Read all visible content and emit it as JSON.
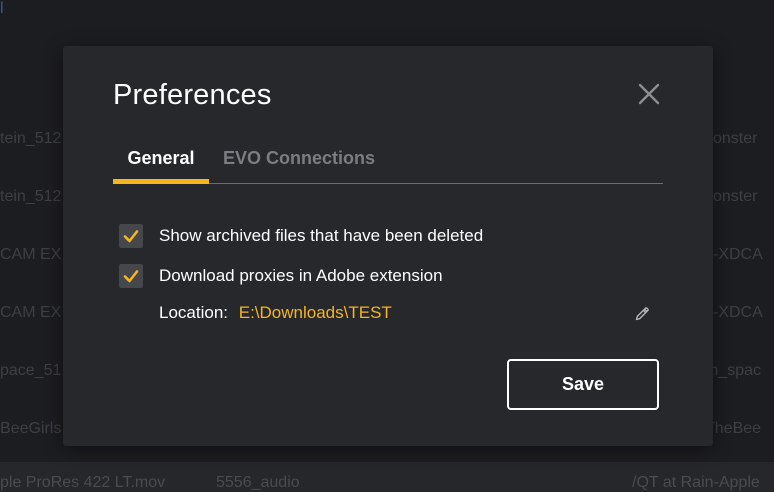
{
  "background": {
    "top_glyph": "l",
    "rows": [
      {
        "left": "tein_512",
        "right": "konster"
      },
      {
        "left": "tein_512",
        "right": "konster"
      },
      {
        "left": "CAM EX",
        "right": "k-XDCA"
      },
      {
        "left": "CAM EX",
        "right": "k-XDCA"
      },
      {
        "left": "pace_51",
        "right": "m_spac"
      },
      {
        "left": "BeeGirls",
        "right": "TheBee"
      }
    ],
    "bottom": [
      "ple ProRes 422 LT.mov",
      "5556_audio",
      "/QT at Rain-Apple"
    ]
  },
  "dialog": {
    "title": "Preferences",
    "close_icon": "close-icon",
    "tabs": [
      {
        "label": "General",
        "active": true
      },
      {
        "label": "EVO Connections",
        "active": false
      }
    ],
    "options": [
      {
        "label": "Show archived files that have been deleted",
        "checked": true
      },
      {
        "label": "Download proxies in Adobe extension",
        "checked": true
      }
    ],
    "location": {
      "label": "Location:",
      "path": "E:\\Downloads\\TEST",
      "edit_icon": "pencil-icon"
    },
    "save_label": "Save"
  },
  "colors": {
    "accent": "#f5b51f",
    "dialog_bg": "#26282c",
    "inactive_tab": "#7b7d82",
    "checkbox_bg": "#45474b"
  }
}
